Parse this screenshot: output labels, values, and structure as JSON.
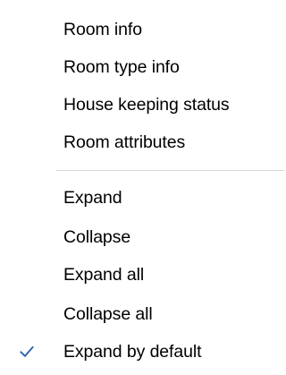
{
  "context_menu": {
    "group1": [
      {
        "label": "Room info",
        "checked": false
      },
      {
        "label": "Room type info",
        "checked": false
      },
      {
        "label": "House keeping status",
        "checked": false
      },
      {
        "label": "Room attributes",
        "checked": false
      }
    ],
    "group2": [
      {
        "label": "Expand",
        "checked": false
      },
      {
        "label": "Collapse",
        "checked": false
      },
      {
        "label": "Expand all",
        "checked": false
      },
      {
        "label": "Collapse all",
        "checked": false
      },
      {
        "label": "Expand by default",
        "checked": true
      }
    ],
    "check_icon": "checkmark-icon",
    "check_color": "#2f6ab5"
  }
}
